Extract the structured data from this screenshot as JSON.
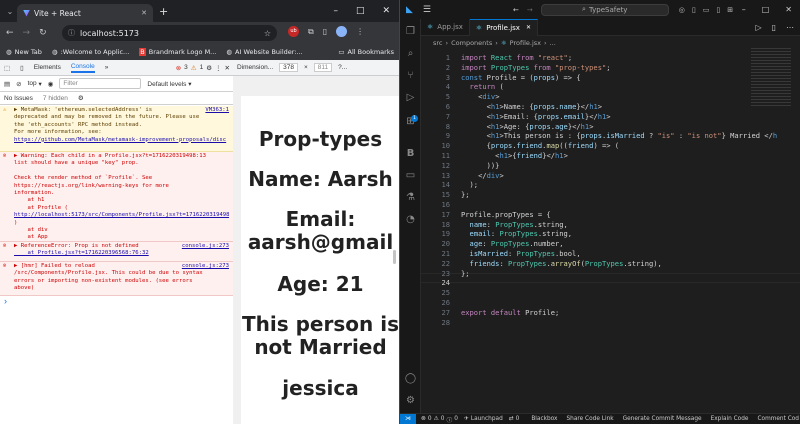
{
  "browser": {
    "tab_title": "Vite + React",
    "new_tab_label": "+",
    "url": "localhost:5173",
    "bookmarks": [
      {
        "label": "New Tab"
      },
      {
        "label": ":Welcome to Applic..."
      },
      {
        "label": "Brandmark Logo M..."
      },
      {
        "label": "AI Website Builder:..."
      }
    ],
    "all_bookmarks": "All Bookmarks",
    "window_controls": {
      "minimize": "–",
      "maximize": "□",
      "close": "✕"
    }
  },
  "devtools": {
    "tabs": [
      "Elements",
      "Console"
    ],
    "error_count": "3",
    "warning_count": "1",
    "context": "top",
    "filter_placeholder": "Filter",
    "levels": "Default levels ▾",
    "no_issues": "No Issues",
    "hidden": "7 hidden",
    "messages": [
      {
        "kind": "warn",
        "lines": [
          "▶ MetaMask: 'ethereum.selectedAddress' is",
          "deprecated and may be removed in the future. Please use",
          "the 'eth_accounts' RPC method instead.",
          "For more information, see:"
        ],
        "link": "https://github.com/MetaMask/metamask-improvement-proposals/disc",
        "source": "VM363:1"
      },
      {
        "kind": "err",
        "lines": [
          "▶ Warning: Each child in a  Profile.jsx?t=1716220319498:13",
          "list should have a unique \"key\" prop.",
          "",
          "Check the render method of `Profile`. See",
          "https://reactjs.org/link/warning-keys for more",
          "information.",
          "    at h1",
          "    at Profile (",
          "http://localhost:5173/src/Components/Profile.jsx?t=1716220319498",
          ")",
          "    at div",
          "    at App"
        ]
      },
      {
        "kind": "err",
        "lines": [
          "▶ ReferenceError: Prop is not defined",
          "    at Profile.jsx?t=1716220396568:76:32"
        ],
        "source": "console.js:273"
      },
      {
        "kind": "err",
        "lines": [
          "▶ [hmr] Failed to reload",
          "/src/Components/Profile.jsx. This could be due to syntax",
          "errors or importing non-existent modules. (see errors",
          "above)"
        ],
        "source": "console.js:273"
      }
    ],
    "prompt": "›"
  },
  "viewport": {
    "dimensions_label": "Dimension...",
    "width": "378",
    "height": "811",
    "zoom": "?..."
  },
  "rendered_page": {
    "lines": [
      "Prop-types",
      "Name: Aarsh",
      "Email:",
      "aarsh@gmail",
      "Age: 21",
      "This person is",
      "not Married",
      "jessica"
    ]
  },
  "vscode": {
    "search": "TypeSafety",
    "tabs": [
      {
        "label": "App.jsx"
      },
      {
        "label": "Profile.jsx",
        "active": true
      }
    ],
    "breadcrumb": [
      "src",
      "Components",
      "Profile.jsx",
      "..."
    ],
    "code_lines": [
      "import React from \"react\";",
      "import PropTypes from \"prop-types\";",
      "const Profile = (props) => {",
      "  return (",
      "    <div>",
      "      <h1>Name: {props.name}</h1>",
      "      <h1>Email: {props.email}</h1>",
      "      <h1>Age: {props.age}</h1>",
      "      <h1>This person is : {props.isMarried ? \"is\" : \"is not\"} Married </h",
      "      {props.friend.map((friend) => (",
      "        <h1>{friend}</h1>",
      "      ))}",
      "    </div>",
      "  );",
      "};",
      "",
      "Profile.propTypes = {",
      "  name: PropTypes.string,",
      "  email: PropTypes.string,",
      "  age: PropTypes.number,",
      "  isMarried: PropTypes.bool,",
      "  friends: PropTypes.arrayOf(PropTypes.string),",
      "};",
      "",
      "",
      "",
      "export default Profile;",
      ""
    ],
    "status": [
      "0",
      "0",
      "0",
      "Launchpad",
      "0",
      "Blackbox",
      "Share Code Link",
      "Generate Commit Message",
      "Explain Code",
      "Comment Cod"
    ]
  }
}
